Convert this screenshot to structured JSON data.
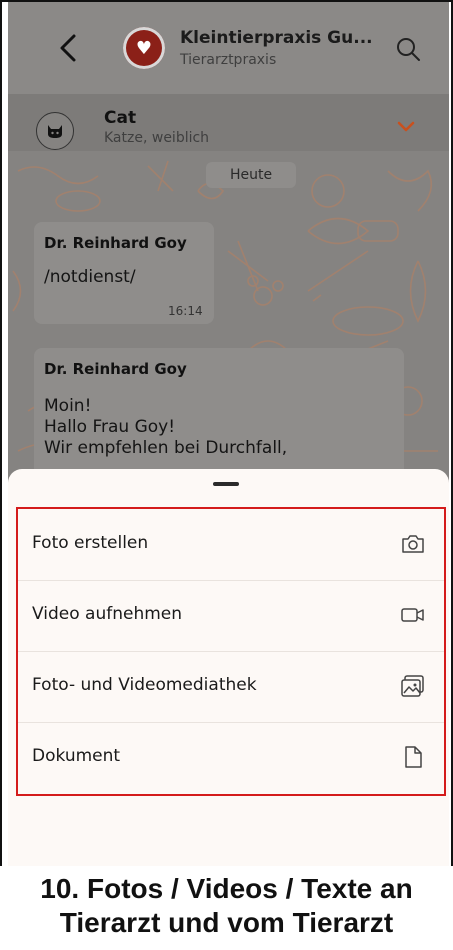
{
  "header": {
    "title": "Kleintierpraxis Gu...",
    "subtitle": "Tierarztpraxis"
  },
  "pet": {
    "name": "Cat",
    "description": "Katze, weiblich"
  },
  "chat": {
    "date_chip": "Heute",
    "messages": [
      {
        "sender": "Dr. Reinhard Goy",
        "text": "/notdienst/",
        "time": "16:14"
      },
      {
        "sender": "Dr. Reinhard Goy",
        "text": "Moin!\nHallo Frau Goy!\nWir empfehlen bei Durchfall,"
      }
    ]
  },
  "attach_menu": {
    "items": [
      {
        "label": "Foto erstellen",
        "icon": "camera-icon"
      },
      {
        "label": "Video aufnehmen",
        "icon": "video-camera-icon"
      },
      {
        "label": "Foto- und Videomediathek",
        "icon": "photo-library-icon"
      },
      {
        "label": "Dokument",
        "icon": "document-icon"
      }
    ]
  },
  "caption": {
    "line1": "10. Fotos / Videos / Texte an",
    "line2": "Tierarzt und vom Tierarzt"
  },
  "colors": {
    "highlight_border": "#d41c1c",
    "pattern_stroke": "#b88060",
    "logo_red": "#8b2018",
    "chevron_orange": "#c9501d"
  }
}
